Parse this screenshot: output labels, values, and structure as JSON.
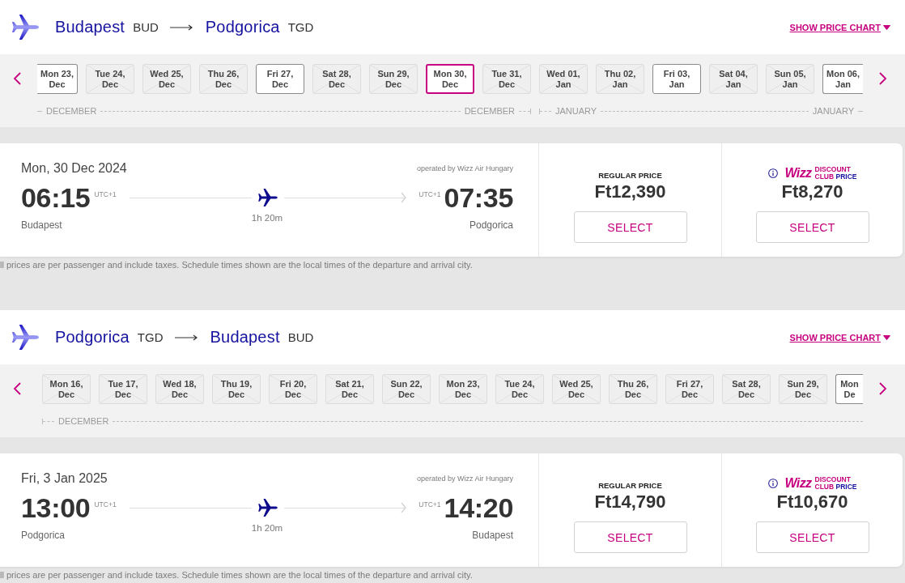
{
  "trips": [
    {
      "from": {
        "city": "Budapest",
        "code": "BUD"
      },
      "to": {
        "city": "Podgorica",
        "code": "TGD"
      },
      "price_chart_link": "SHOW PRICE CHART",
      "date_strip": {
        "first_tile_cut": true,
        "last_tile_cut": true,
        "months": [
          {
            "start_label": "DECEMBER",
            "end_label": "DECEMBER",
            "dates": [
              {
                "day": "Mon 23,",
                "month": "Dec",
                "available": true,
                "selected": false
              },
              {
                "day": "Tue 24,",
                "month": "Dec",
                "available": false,
                "selected": false
              },
              {
                "day": "Wed 25,",
                "month": "Dec",
                "available": false,
                "selected": false
              },
              {
                "day": "Thu 26,",
                "month": "Dec",
                "available": false,
                "selected": false
              },
              {
                "day": "Fri 27,",
                "month": "Dec",
                "available": true,
                "selected": false
              },
              {
                "day": "Sat 28,",
                "month": "Dec",
                "available": false,
                "selected": false
              },
              {
                "day": "Sun 29,",
                "month": "Dec",
                "available": false,
                "selected": false
              },
              {
                "day": "Mon 30,",
                "month": "Dec",
                "available": true,
                "selected": true
              },
              {
                "day": "Tue 31,",
                "month": "Dec",
                "available": false,
                "selected": false
              }
            ]
          },
          {
            "start_label": "JANUARY",
            "end_label": "JANUARY",
            "dates": [
              {
                "day": "Wed 01,",
                "month": "Jan",
                "available": false,
                "selected": false
              },
              {
                "day": "Thu 02,",
                "month": "Jan",
                "available": false,
                "selected": false
              },
              {
                "day": "Fri 03,",
                "month": "Jan",
                "available": true,
                "selected": false
              },
              {
                "day": "Sat 04,",
                "month": "Jan",
                "available": false,
                "selected": false
              },
              {
                "day": "Sun 05,",
                "month": "Jan",
                "available": false,
                "selected": false
              },
              {
                "day": "Mon 06,",
                "month": "Jan",
                "available": true,
                "selected": false
              }
            ]
          }
        ]
      },
      "flight": {
        "date": "Mon, 30 Dec 2024",
        "operator": "operated by Wizz Air Hungary",
        "departure": {
          "time": "06:15",
          "timezone": "UTC+1",
          "city": "Budapest"
        },
        "arrival": {
          "time": "07:35",
          "timezone": "UTC+1",
          "city": "Podgorica"
        },
        "duration": "1h 20m",
        "fares": [
          {
            "kind": "regular",
            "label": "REGULAR PRICE",
            "price": "Ft12,390",
            "button": "SELECT"
          },
          {
            "kind": "club",
            "logo": "Wizz",
            "label_line_1": "DISCOUNT",
            "label_line_2": "CLUB",
            "label_line_2_end": "PRICE",
            "price": "Ft8,270",
            "button": "SELECT"
          }
        ]
      },
      "note": "ll prices are per passenger and include taxes. Schedule times shown are the local times of the departure and arrival city."
    },
    {
      "from": {
        "city": "Podgorica",
        "code": "TGD"
      },
      "to": {
        "city": "Budapest",
        "code": "BUD"
      },
      "price_chart_link": "SHOW PRICE CHART",
      "date_strip": {
        "first_tile_cut": false,
        "last_tile_cut": true,
        "months": [
          {
            "start_label": "DECEMBER",
            "dates": [
              {
                "day": "Mon 16,",
                "month": "Dec",
                "available": false,
                "selected": false
              },
              {
                "day": "Tue 17,",
                "month": "Dec",
                "available": false,
                "selected": false
              },
              {
                "day": "Wed 18,",
                "month": "Dec",
                "available": false,
                "selected": false
              },
              {
                "day": "Thu 19,",
                "month": "Dec",
                "available": false,
                "selected": false
              },
              {
                "day": "Fri 20,",
                "month": "Dec",
                "available": false,
                "selected": false
              },
              {
                "day": "Sat 21,",
                "month": "Dec",
                "available": false,
                "selected": false
              },
              {
                "day": "Sun 22,",
                "month": "Dec",
                "available": false,
                "selected": false
              },
              {
                "day": "Mon 23,",
                "month": "Dec",
                "available": false,
                "selected": false
              },
              {
                "day": "Tue 24,",
                "month": "Dec",
                "available": false,
                "selected": false
              },
              {
                "day": "Wed 25,",
                "month": "Dec",
                "available": false,
                "selected": false
              },
              {
                "day": "Thu 26,",
                "month": "Dec",
                "available": false,
                "selected": false
              },
              {
                "day": "Fri 27,",
                "month": "Dec",
                "available": false,
                "selected": false
              },
              {
                "day": "Sat 28,",
                "month": "Dec",
                "available": false,
                "selected": false
              },
              {
                "day": "Sun 29,",
                "month": "Dec",
                "available": false,
                "selected": false
              },
              {
                "day": "Mon",
                "month": "De",
                "available": true,
                "selected": false
              }
            ]
          }
        ]
      },
      "flight": {
        "date": "Fri, 3 Jan 2025",
        "operator": "operated by Wizz Air Hungary",
        "departure": {
          "time": "13:00",
          "timezone": "UTC+1",
          "city": "Podgorica"
        },
        "arrival": {
          "time": "14:20",
          "timezone": "UTC+1",
          "city": "Budapest"
        },
        "duration": "1h 20m",
        "fares": [
          {
            "kind": "regular",
            "label": "REGULAR PRICE",
            "price": "Ft14,790",
            "button": "SELECT"
          },
          {
            "kind": "club",
            "logo": "Wizz",
            "label_line_1": "DISCOUNT",
            "label_line_2": "CLUB",
            "label_line_2_end": "PRICE",
            "price": "Ft10,670",
            "button": "SELECT"
          }
        ]
      },
      "note": "ll prices are per passenger and include taxes. Schedule times shown are the local times of the departure and arrival city."
    }
  ]
}
